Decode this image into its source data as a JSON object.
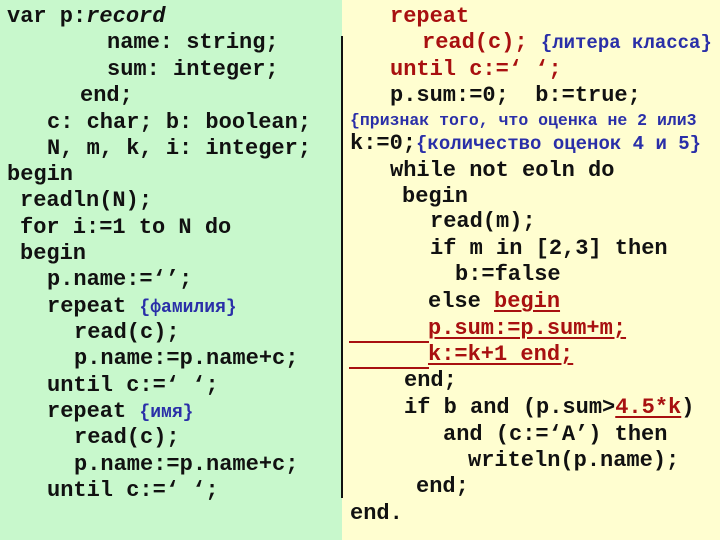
{
  "colors": {
    "left_background": "#c8f8cc",
    "right_background": "#fffed0",
    "code": "#111111",
    "comment": "#2a2fa8",
    "highlight": "#a81010"
  },
  "left_code": [
    [
      {
        "t": "var p:",
        "s": "k"
      },
      {
        "t": "record",
        "s": "i"
      }
    ],
    [
      {
        "t": "name: string;",
        "s": "k"
      }
    ],
    [
      {
        "t": "sum: integer;",
        "s": "k"
      }
    ],
    [
      {
        "t": "end;",
        "s": "k"
      }
    ],
    [
      {
        "t": "c: char; b: boolean;",
        "s": "k"
      }
    ],
    [
      {
        "t": "N, m, k, i: integer;",
        "s": "k"
      }
    ],
    [
      {
        "t": "begin",
        "s": "k"
      }
    ],
    [
      {
        "t": "readln(N);",
        "s": "k"
      }
    ],
    [
      {
        "t": "for i:=1 to N do",
        "s": "k"
      }
    ],
    [
      {
        "t": "begin",
        "s": "k"
      }
    ],
    [
      {
        "t": "p.name:=‘’;",
        "s": "k"
      }
    ],
    [
      {
        "t": "repeat ",
        "s": "k"
      },
      {
        "t": "{фамилия}",
        "s": "c"
      }
    ],
    [
      {
        "t": "read(c);",
        "s": "k"
      }
    ],
    [
      {
        "t": "p.name:=p.name+c;",
        "s": "k"
      }
    ],
    [
      {
        "t": "until c:=‘ ‘;",
        "s": "k"
      }
    ],
    [
      {
        "t": "repeat ",
        "s": "k"
      },
      {
        "t": "{имя}",
        "s": "c"
      }
    ],
    [
      {
        "t": "read(c);",
        "s": "k"
      }
    ],
    [
      {
        "t": "p.name:=p.name+c;",
        "s": "k"
      }
    ],
    [
      {
        "t": "until c:=‘ ‘;",
        "s": "k"
      }
    ]
  ],
  "right_code": [
    [
      {
        "t": "repeat",
        "s": "r"
      }
    ],
    [
      {
        "t": "read(c); ",
        "s": "r"
      },
      {
        "t": "{литера класса}",
        "s": "cl"
      }
    ],
    [
      {
        "t": "until c:=‘ ‘;",
        "s": "r"
      }
    ],
    [
      {
        "t": "p.sum:=0;  b:=true;",
        "s": "k"
      }
    ],
    [
      {
        "t": "{признак того, что оценка не 2 или3",
        "s": "cs"
      }
    ],
    [
      {
        "t": "k:=0;",
        "s": "k"
      },
      {
        "t": "{количество оценок 4 и 5}",
        "s": "cl"
      }
    ],
    [
      {
        "t": "while not eoln do",
        "s": "k"
      }
    ],
    [
      {
        "t": "begin",
        "s": "k"
      }
    ],
    [
      {
        "t": "read(m);",
        "s": "k"
      }
    ],
    [
      {
        "t": "if m in [2,3] then",
        "s": "k"
      }
    ],
    [
      {
        "t": "b:=false",
        "s": "k"
      }
    ],
    [
      {
        "t": "else ",
        "s": "k"
      },
      {
        "t": "begin",
        "s": "ru"
      }
    ],
    [
      {
        "t": "p.sum:=p.sum+m;",
        "s": "ru"
      }
    ],
    [
      {
        "t": "k:=k+1 end;",
        "s": "ru"
      }
    ],
    [
      {
        "t": "end;",
        "s": "k"
      }
    ],
    [
      {
        "t": "if b and (p.sum>",
        "s": "k"
      },
      {
        "t": "4.5*k",
        "s": "ru"
      },
      {
        "t": ")",
        "s": "k"
      }
    ],
    [
      {
        "t": "and (c:=‘A’) then",
        "s": "k"
      }
    ],
    [
      {
        "t": "writeln(p.name);",
        "s": "k"
      }
    ],
    [
      {
        "t": "end;",
        "s": "k"
      }
    ],
    [
      {
        "t": "end.",
        "s": "k"
      }
    ]
  ]
}
